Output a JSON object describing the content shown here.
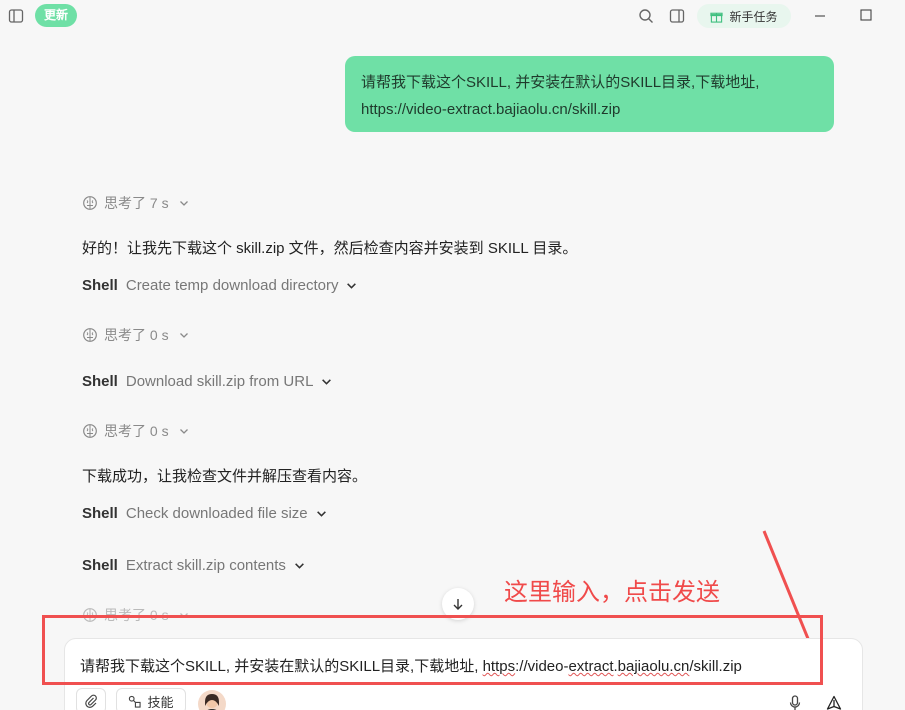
{
  "topbar": {
    "update_badge": "更新",
    "task_button_label": "新手任务"
  },
  "conversation": {
    "user_message_line1": "请帮我下载这个SKILL, 并安装在默认的SKILL目录,下载地址,",
    "user_message_line2": "https://video-extract.bajiaolu.cn/skill.zip",
    "think_1": "思考了 7 s",
    "reply_1": "好的！让我先下载这个 skill.zip 文件，然后检查内容并安装到 SKILL 目录。",
    "shell_1": {
      "keyword": "Shell",
      "desc": "Create temp download directory"
    },
    "think_2": "思考了 0 s",
    "shell_2": {
      "keyword": "Shell",
      "desc": "Download skill.zip from URL"
    },
    "think_3": "思考了 0 s",
    "reply_2": "下载成功，让我检查文件并解压查看内容。",
    "shell_3": {
      "keyword": "Shell",
      "desc": "Check downloaded file size"
    },
    "shell_4": {
      "keyword": "Shell",
      "desc": "Extract skill.zip contents"
    },
    "think_4": "思考了 0 s"
  },
  "annotation": {
    "text": "这里输入，点击发送",
    "color": "#f04a4a"
  },
  "composer": {
    "text_prefix": "请帮我下载这个SKILL, 并安装在默认的SKILL目录,下载地址, ",
    "text_url_part1": "https",
    "text_url_part2": "://video-",
    "text_url_part3": "extract",
    "text_url_part4": ".",
    "text_url_part5": "bajiaolu.cn",
    "text_url_part6": "/skill.zip",
    "skills_label": "技能"
  },
  "colors": {
    "accent_green": "#6fe0a6",
    "annotation_red": "#f05050"
  }
}
